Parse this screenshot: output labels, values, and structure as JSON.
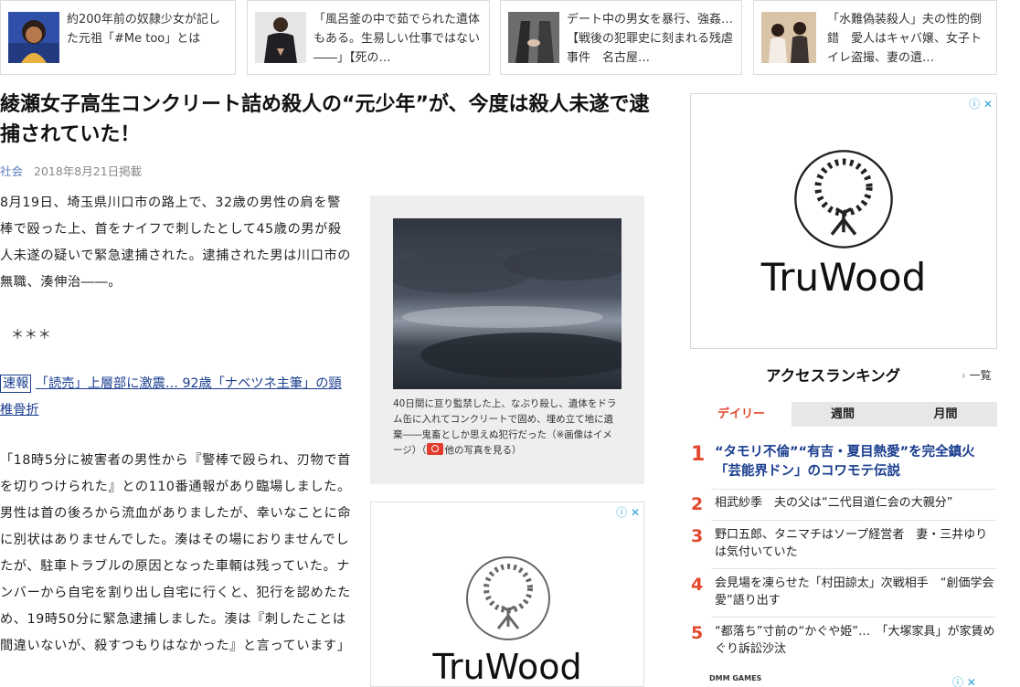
{
  "related": [
    {
      "text": "約200年前の奴隷少女が記した元祖「#Me too」とは",
      "thumb": "woman-portrait-thumb"
    },
    {
      "text": "「風呂釜の中で茹でられた遺体もある。生易しい仕事ではない――」【死の…",
      "thumb": "suited-man-thumb"
    },
    {
      "text": "デート中の男女を暴行、強姦…【戦後の犯罪史に刻まれる残虐事件　名古屋…",
      "thumb": "couple-handhold-thumb"
    },
    {
      "text": "「水難偽装殺人」夫の性的倒錯　愛人はキャバ嬢、女子トイレ盗撮、妻の遺…",
      "thumb": "wedding-couple-thumb"
    }
  ],
  "article": {
    "title": "綾瀬女子高生コンクリート詰め殺人の“元少年”が、今度は殺人未遂で逮捕されていた！",
    "category": "社会",
    "date": "2018年8月21日掲載",
    "p1": "8月19日、埼玉県川口市の路上で、32歳の男性の肩を警棒で殴った上、首をナイフで刺したとして45歳の男が殺人未遂の疑いで緊急逮捕された。逮捕された男は川口市の無職、湊伸治――。",
    "stars": "＊＊＊",
    "link_tag": "速報",
    "link_text": "「読売」上層部に激震… 92歳「ナベツネ主筆」の頸椎骨折",
    "p2": "「18時5分に被害者の男性から『警棒で殴られ、刃物で首を切りつけられた』との110番通報があり臨場しました。男性は首の後ろから流血がありましたが、幸いなことに命に別状はありませんでした。湊はその場におりませんでしたが、駐車トラブルの原因となった車輌は残っていた。ナンバーから自宅を割り出し自宅に行くと、犯行を認めたため、19時50分に緊急逮捕しました。湊は『刺したことは間違いないが、殺すつもりはなかった』と言っています」"
  },
  "figure": {
    "caption": "40日間に亘り監禁した上、なぶり殺し、遺体をドラム缶に入れてコンクリートで固め、埋め立て地に遺棄――鬼畜としか思えぬ犯行だった（※画像はイメージ）（",
    "more_photos": "他の写真を見る）",
    "photo": "stormy-sky-photo"
  },
  "ads": {
    "brand": "TruWood",
    "choices": "ⓘ ✕"
  },
  "ranking": {
    "title": "アクセスランキング",
    "more": "一覧",
    "tabs": [
      "デイリー",
      "週間",
      "月間"
    ],
    "active_tab": 0,
    "items": [
      {
        "rank": "1",
        "text": "“タモリ不倫”“有吉・夏目熱愛”を完全鎮火「芸能界ドン」のコワモテ伝説"
      },
      {
        "rank": "2",
        "text": "相武紗季　夫の父は“二代目道仁会の大親分”"
      },
      {
        "rank": "3",
        "text": "野口五郎、タニマチはソープ経営者　妻・三井ゆりは気付いていた"
      },
      {
        "rank": "4",
        "text": "会見場を凍らせた「村田諒太」次戦相手　“創価学会愛”語り出す"
      },
      {
        "rank": "5",
        "text": "“都落ち”寸前の“かぐや姫”…　「大塚家具」が家賃めぐり訴訟沙汰"
      }
    ],
    "footer_brand": "DMM GAMES"
  },
  "colors": {
    "accent_red": "#e3482e",
    "link_blue": "#1a3d8f",
    "ad_blue": "#2aa3d6"
  }
}
